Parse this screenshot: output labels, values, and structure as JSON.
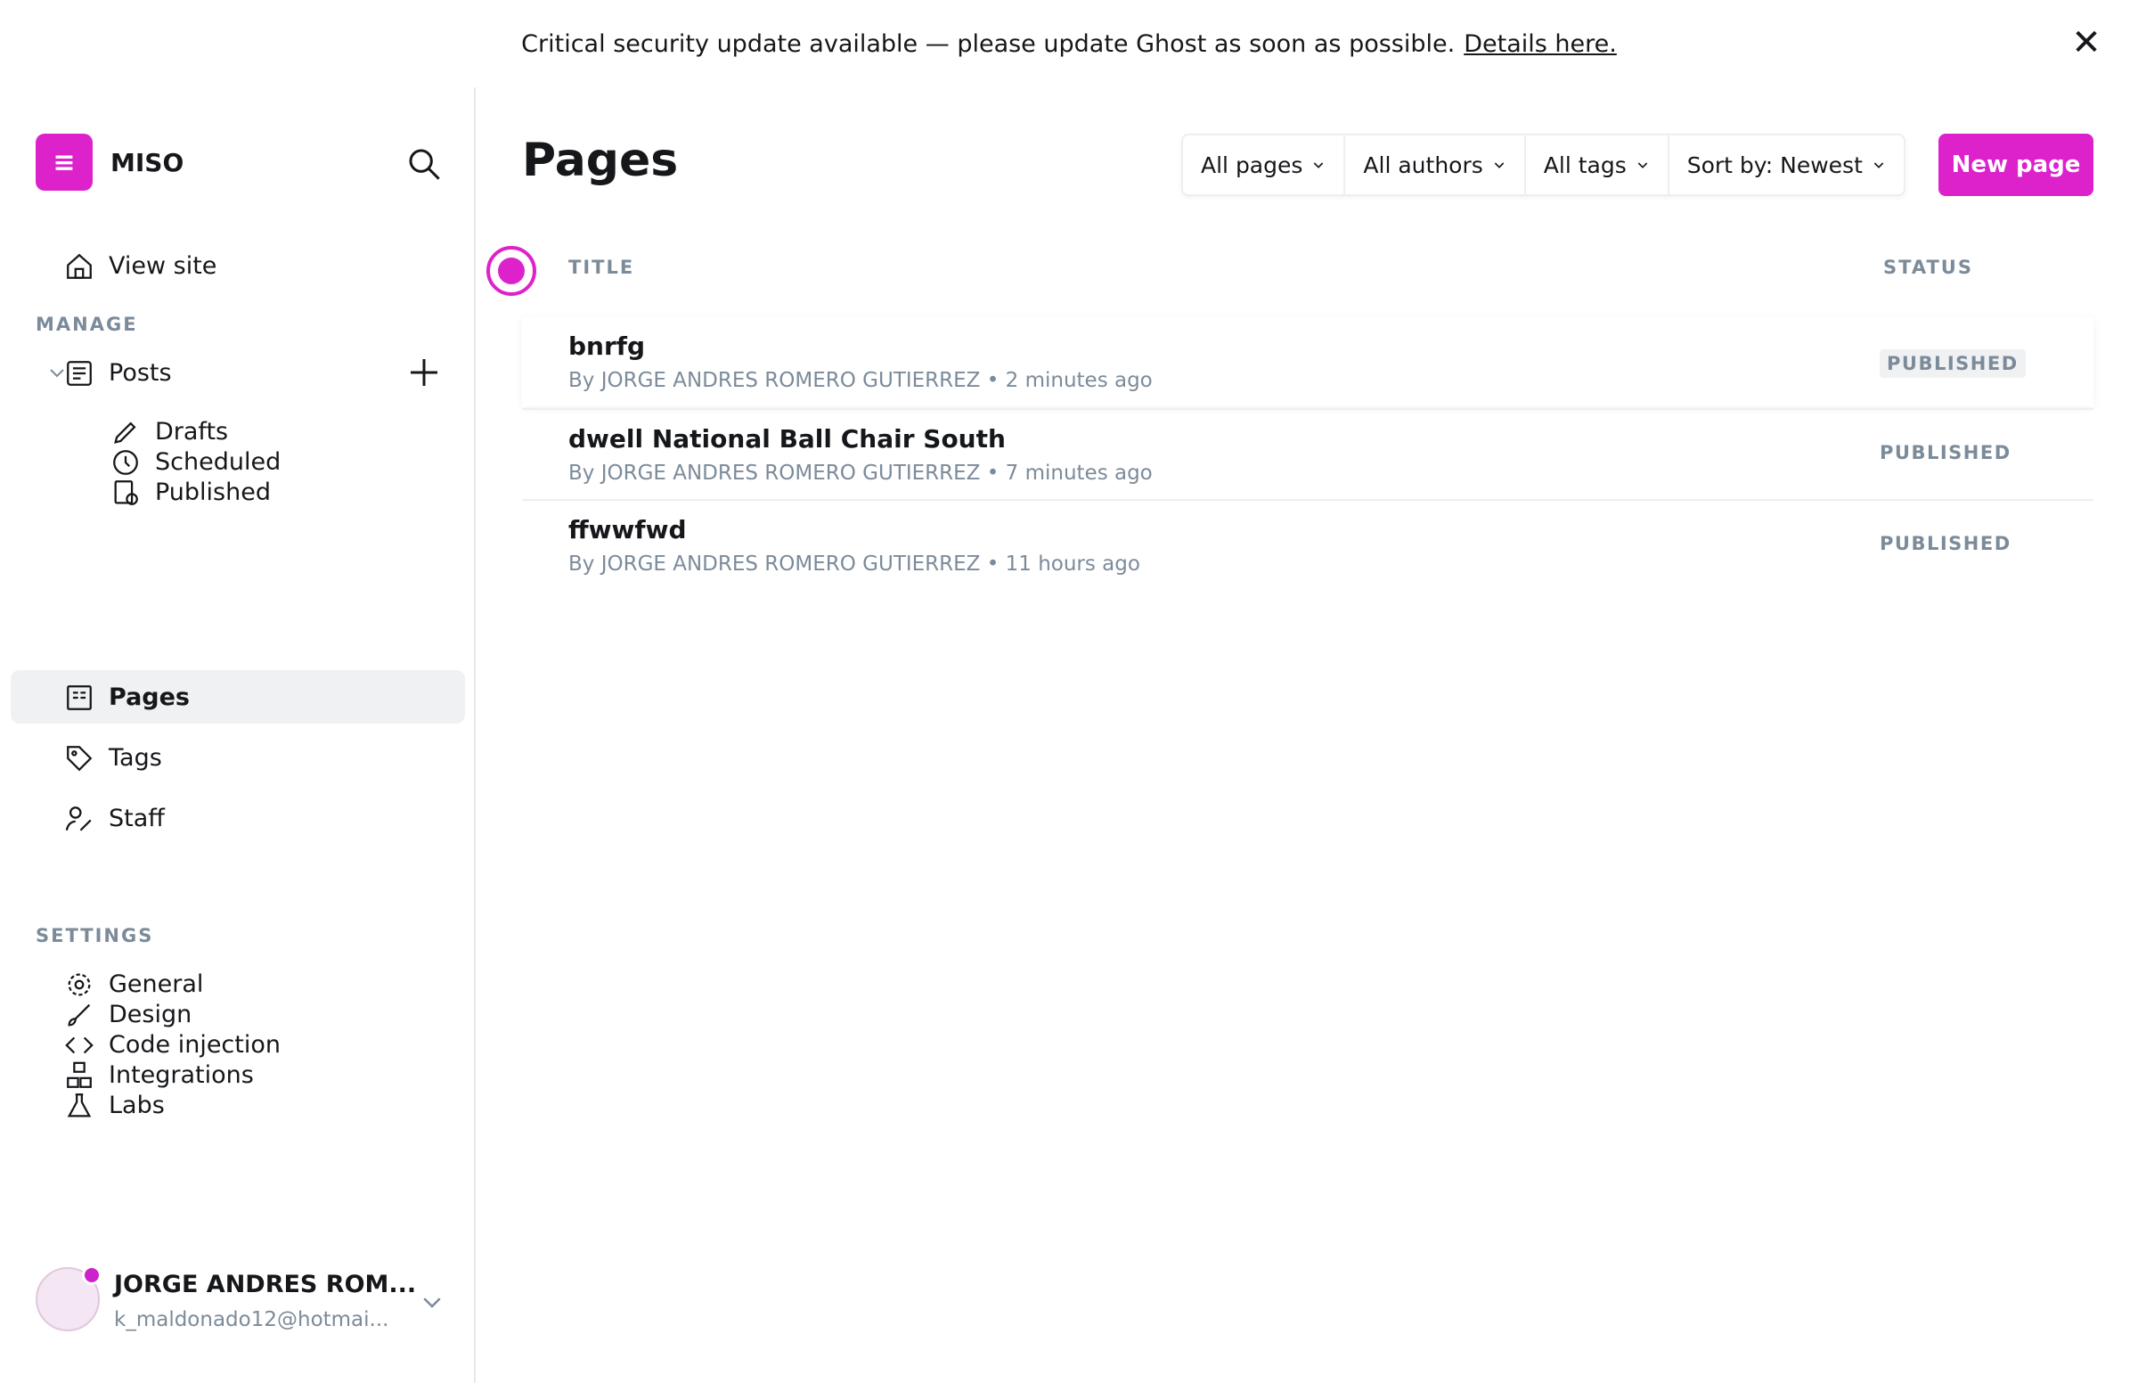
{
  "banner": {
    "message": "Critical security update available — please update Ghost as soon as possible.",
    "link_text": "Details here.",
    "close": "✕"
  },
  "brand": {
    "name": "MISO",
    "logo_text": "≡"
  },
  "sidebar": {
    "view_site": "View site",
    "manage_title": "MANAGE",
    "posts": "Posts",
    "drafts": "Drafts",
    "scheduled": "Scheduled",
    "published": "Published",
    "pages": "Pages",
    "tags": "Tags",
    "staff": "Staff",
    "settings_title": "SETTINGS",
    "general": "General",
    "design": "Design",
    "code_injection": "Code injection",
    "integrations": "Integrations",
    "labs": "Labs"
  },
  "user": {
    "name": "JORGE ANDRES ROM...",
    "email": "k_maldonado12@hotmai..."
  },
  "main": {
    "title": "Pages",
    "filters": [
      "All pages",
      "All authors",
      "All tags",
      "Sort by: Newest"
    ],
    "new_button": "New page",
    "head_title": "TITLE",
    "head_status": "STATUS",
    "rows": [
      {
        "title": "bnrfg",
        "meta": "By JORGE ANDRES ROMERO GUTIERREZ • 2 minutes ago",
        "status": "PUBLISHED"
      },
      {
        "title": "dwell National Ball Chair South",
        "meta": "By JORGE ANDRES ROMERO GUTIERREZ • 7 minutes ago",
        "status": "PUBLISHED"
      },
      {
        "title": "ffwwfwd",
        "meta": "By JORGE ANDRES ROMERO GUTIERREZ • 11 hours ago",
        "status": "PUBLISHED"
      }
    ]
  },
  "colors": {
    "accent": "#dd22cc",
    "muted": "#7c8b9a",
    "text": "#15171a"
  }
}
